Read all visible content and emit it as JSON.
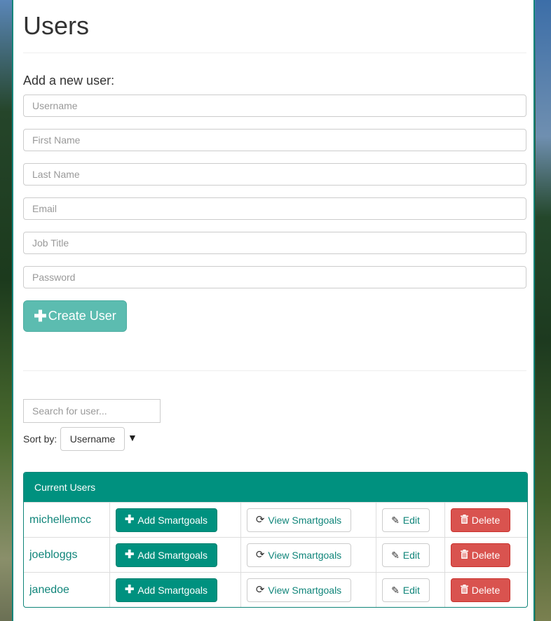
{
  "page": {
    "title": "Users"
  },
  "form": {
    "heading": "Add a new user:",
    "fields": [
      {
        "name": "username",
        "placeholder": "Username",
        "value": ""
      },
      {
        "name": "first_name",
        "placeholder": "First Name",
        "value": ""
      },
      {
        "name": "last_name",
        "placeholder": "Last Name",
        "value": ""
      },
      {
        "name": "email",
        "placeholder": "Email",
        "value": ""
      },
      {
        "name": "job_title",
        "placeholder": "Job Title",
        "value": ""
      },
      {
        "name": "password",
        "placeholder": "Password",
        "value": ""
      }
    ],
    "submit_label": "Create User",
    "submit_icon": "plus-icon"
  },
  "search": {
    "placeholder": "Search for user...",
    "value": ""
  },
  "sort": {
    "label": "Sort by:",
    "selected": "Username",
    "arrow": "▼"
  },
  "users_panel": {
    "heading": "Current Users",
    "actions": {
      "add": "Add Smartgoals",
      "view": "View Smartgoals",
      "edit": "Edit",
      "delete": "Delete"
    },
    "rows": [
      {
        "username": "michellemcc"
      },
      {
        "username": "joebloggs"
      },
      {
        "username": "janedoe"
      }
    ]
  },
  "colors": {
    "accent": "#00917f",
    "accent_light": "#5cbcb0",
    "danger": "#d9534f",
    "link": "#10857a"
  }
}
